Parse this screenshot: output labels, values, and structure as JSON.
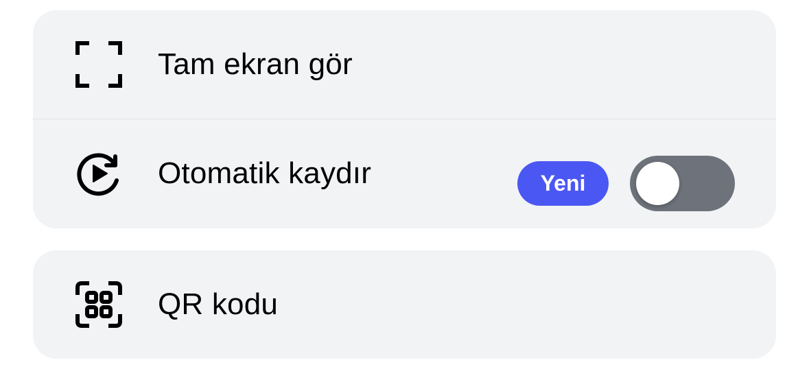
{
  "colors": {
    "card_background": "#f2f3f5",
    "badge_background": "#4b57f2",
    "toggle_off_track": "#6d727b",
    "icon": "#000000"
  },
  "menu": {
    "groups": [
      {
        "items": [
          {
            "label": "Tam ekran gör",
            "icon": "fullscreen-icon"
          },
          {
            "label": "Otomatik kaydır",
            "icon": "autoscroll-play-icon",
            "badge": "Yeni",
            "toggle": {
              "on": false
            }
          }
        ]
      },
      {
        "items": [
          {
            "label": "QR kodu",
            "icon": "qr-code-icon"
          }
        ]
      }
    ]
  }
}
